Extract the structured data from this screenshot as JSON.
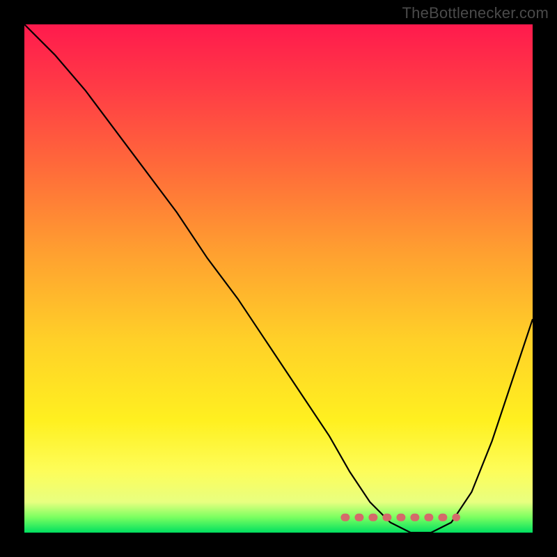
{
  "watermark": "TheBottlenecker.com",
  "chart_data": {
    "type": "line",
    "title": "",
    "xlabel": "",
    "ylabel": "",
    "xlim": [
      0,
      100
    ],
    "ylim": [
      0,
      100
    ],
    "series": [
      {
        "name": "bottleneck-curve",
        "x": [
          0,
          6,
          12,
          18,
          24,
          30,
          36,
          42,
          48,
          54,
          60,
          64,
          68,
          72,
          76,
          80,
          84,
          88,
          92,
          96,
          100
        ],
        "y": [
          100,
          94,
          87,
          79,
          71,
          63,
          54,
          46,
          37,
          28,
          19,
          12,
          6,
          2,
          0,
          0,
          2,
          8,
          18,
          30,
          42
        ]
      },
      {
        "name": "optimal-range-marker",
        "x": [
          63,
          85
        ],
        "y": [
          3,
          3
        ]
      }
    ],
    "colors": {
      "gradient_top": "#ff1a4d",
      "gradient_bottom": "#00e060",
      "curve": "#000000",
      "marker": "#d46a6a"
    }
  }
}
